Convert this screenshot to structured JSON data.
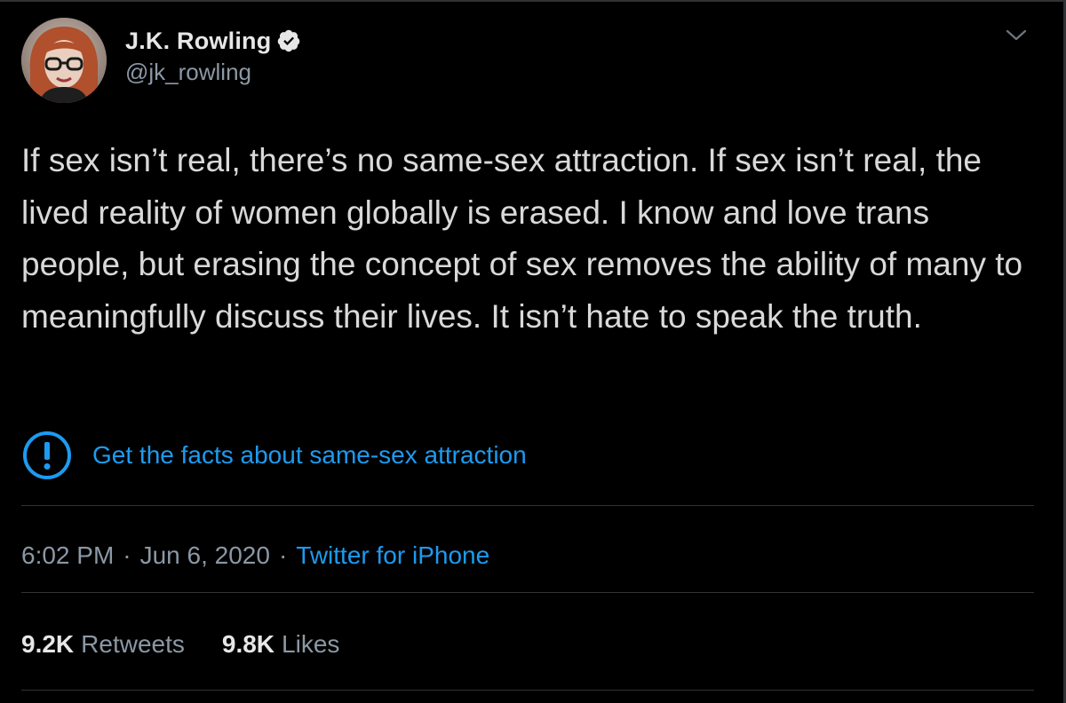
{
  "author": {
    "display_name": "J.K. Rowling",
    "handle": "@jk_rowling",
    "verified_icon": "verified-badge-icon"
  },
  "tweet": {
    "text": "If sex isn’t real, there’s no same-sex attraction. If sex isn’t real, the lived reality of women globally is erased. I know and love trans people, but erasing the concept of sex removes the ability of many to meaningfully discuss their lives. It isn’t hate to speak the truth."
  },
  "notice": {
    "icon": "exclamation-circle-icon",
    "link_text": "Get the facts about same-sex attraction"
  },
  "meta": {
    "time": "6:02 PM",
    "separator": "·",
    "date": "Jun 6, 2020",
    "source": "Twitter for iPhone"
  },
  "stats": {
    "retweets_count": "9.2K",
    "retweets_label": "Retweets",
    "likes_count": "9.8K",
    "likes_label": "Likes"
  },
  "colors": {
    "background": "#000000",
    "link": "#1d9bf0",
    "secondary_text": "#8b98a5",
    "divider": "#2f3336"
  }
}
